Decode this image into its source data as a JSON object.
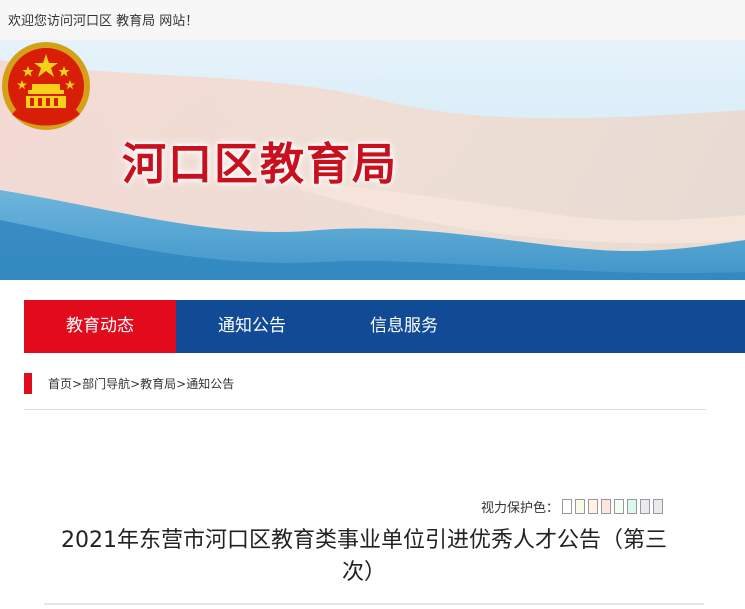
{
  "topbar": {
    "welcome": "欢迎您访问河口区 教育局 网站！"
  },
  "header": {
    "site_title": "河口区教育局",
    "emblem_icon": "national-emblem-icon"
  },
  "nav": {
    "items": [
      {
        "label": "教育动态",
        "active": true
      },
      {
        "label": "通知公告",
        "active": false
      },
      {
        "label": "信息服务",
        "active": false
      }
    ]
  },
  "breadcrumb": {
    "items": [
      "首页",
      "部门导航",
      "教育局",
      "通知公告"
    ],
    "separator": ">"
  },
  "eye_protect": {
    "label": "视力保护色：",
    "swatches": [
      "#ffffff",
      "#fafbe6",
      "#fff2e2",
      "#fde6e0",
      "#f3fff3",
      "#dafaef",
      "#eaeaef",
      "#eaeaea"
    ]
  },
  "article": {
    "title_line1": "2021年东营市河口区教育类事业单位引进优秀人才公告（第三",
    "title_line2": "次）"
  },
  "colors": {
    "nav_blue": "#114a95",
    "nav_active_red": "#e20b1d",
    "title_red": "#c8101e"
  }
}
